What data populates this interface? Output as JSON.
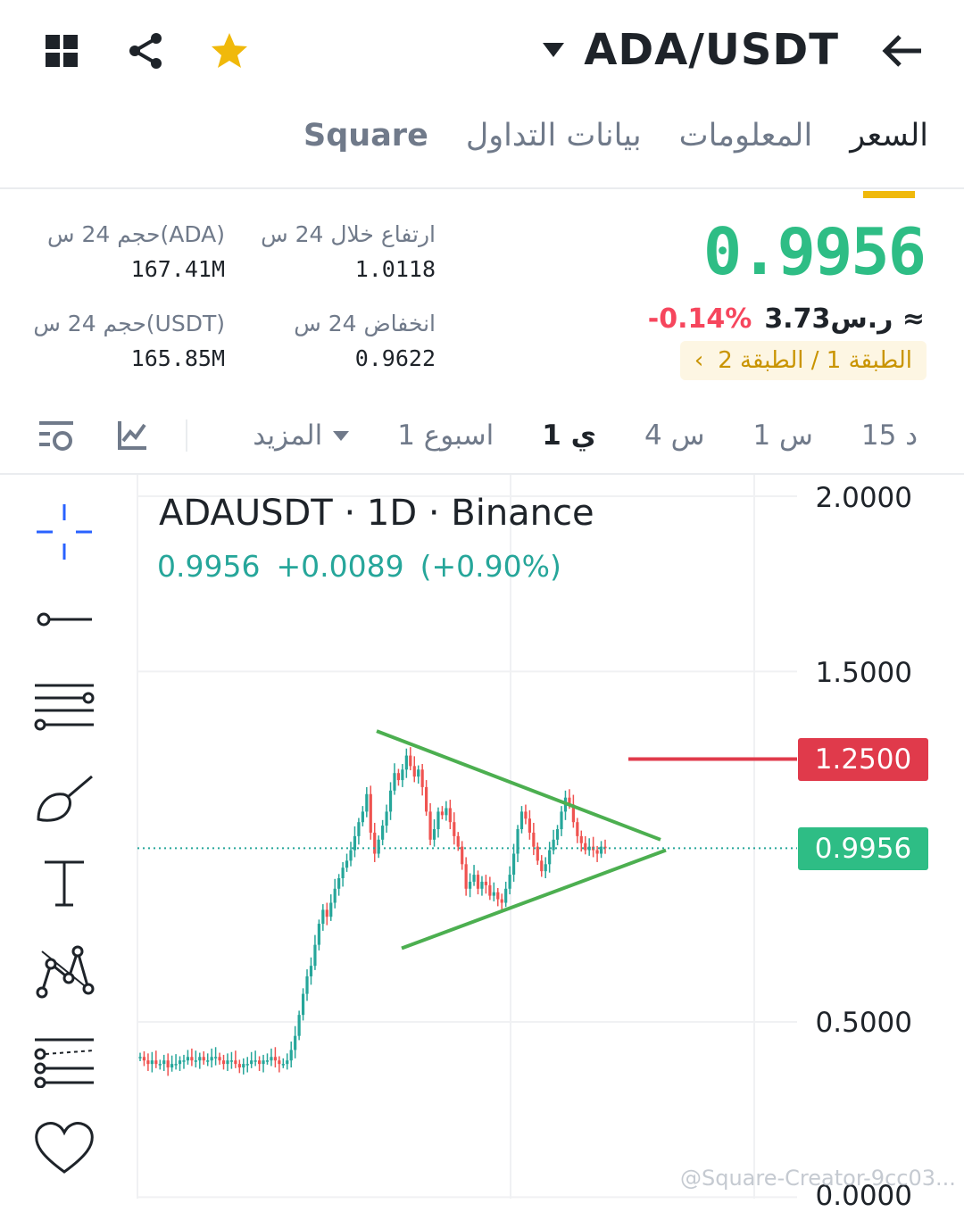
{
  "header": {
    "pair": "ADA/USDT",
    "icons": [
      "grid-icon",
      "share-icon",
      "star-icon",
      "back-arrow-icon"
    ]
  },
  "tabs": [
    {
      "label": "السعر",
      "active": true
    },
    {
      "label": "المعلومات",
      "active": false
    },
    {
      "label": "بيانات التداول",
      "active": false
    },
    {
      "label": "Square",
      "active": false
    }
  ],
  "price": {
    "last": "0.9956",
    "change_pct": "-0.14%",
    "approx": "≈ ر.س3.73",
    "tier": "الطبقة 1 / الطبقة 2"
  },
  "stats": {
    "high_label": "ارتفاع خلال 24 س",
    "high_value": "1.0118",
    "low_label": "انخفاض 24 س",
    "low_value": "0.9622",
    "vol_ada_label": "حجم 24 س(ADA)",
    "vol_ada_value": "167.41M",
    "vol_usdt_label": "حجم 24 س(USDT)",
    "vol_usdt_value": "165.85M"
  },
  "intervals": [
    {
      "label": "15 د",
      "active": false
    },
    {
      "label": "1 س",
      "active": false
    },
    {
      "label": "4 س",
      "active": false
    },
    {
      "label": "1 ي",
      "active": true
    },
    {
      "label": "1 اسبوع",
      "active": false
    },
    {
      "label": "المزيد",
      "active": false
    }
  ],
  "chart_toolbar_icons": [
    "indicator-icon",
    "chart-settings-icon"
  ],
  "chart": {
    "title": "ADAUSDT · 1D · Binance",
    "last": "0.9956",
    "change": "+0.0089",
    "change_pct": "(+0.90%)",
    "y_labels": [
      "2.0000",
      "1.5000",
      "0.5000",
      "0.0000"
    ],
    "line_level_badge": "1.2500",
    "price_badge": "0.9956",
    "colors": {
      "up": "#26a69a",
      "down": "#ef5350",
      "trend": "#4caf50",
      "level": "#e03a4b",
      "price": "#26a69a"
    }
  },
  "drawing_tools": [
    "crosshair-icon",
    "trend-line-icon",
    "fib-levels-icon",
    "brush-icon",
    "text-icon",
    "pattern-icon",
    "prediction-icon",
    "favorites-heart-icon"
  ],
  "watermark": "@Square-Creator-9cc03...",
  "chart_data": {
    "type": "candlestick",
    "title": "ADAUSDT · 1D · Binance",
    "y_ticks": [
      2.0,
      1.5,
      0.5,
      0.0
    ],
    "ylim": [
      0.0,
      2.0
    ],
    "last_price": 0.9956,
    "horizontal_level": 1.25,
    "triangle_upper": {
      "start": 1.33,
      "end": 1.02
    },
    "triangle_lower": {
      "start": 0.71,
      "end": 0.99
    },
    "closes": [
      0.4,
      0.39,
      0.38,
      0.39,
      0.38,
      0.38,
      0.39,
      0.37,
      0.38,
      0.38,
      0.39,
      0.39,
      0.4,
      0.39,
      0.39,
      0.4,
      0.39,
      0.39,
      0.4,
      0.4,
      0.39,
      0.38,
      0.39,
      0.39,
      0.38,
      0.37,
      0.38,
      0.38,
      0.39,
      0.39,
      0.38,
      0.39,
      0.39,
      0.4,
      0.39,
      0.38,
      0.38,
      0.39,
      0.42,
      0.46,
      0.52,
      0.58,
      0.63,
      0.66,
      0.72,
      0.78,
      0.82,
      0.8,
      0.84,
      0.88,
      0.91,
      0.94,
      0.96,
      0.99,
      1.03,
      1.07,
      1.1,
      1.15,
      1.04,
      0.98,
      1.02,
      1.06,
      1.1,
      1.16,
      1.21,
      1.19,
      1.22,
      1.26,
      1.23,
      1.2,
      1.22,
      1.17,
      1.1,
      1.02,
      1.05,
      1.1,
      1.09,
      1.11,
      1.07,
      1.03,
      1.0,
      0.95,
      0.88,
      0.9,
      0.92,
      0.88,
      0.9,
      0.89,
      0.86,
      0.87,
      0.85,
      0.84,
      0.88,
      0.92,
      0.98,
      1.05,
      1.1,
      1.08,
      1.04,
      1.0,
      0.96,
      0.93,
      0.95,
      0.99,
      1.02,
      1.05,
      1.1,
      1.14,
      1.12,
      1.07,
      1.03,
      1.01,
      0.99,
      1.0,
      0.99,
      0.98,
      1.0,
      0.9956
    ]
  }
}
